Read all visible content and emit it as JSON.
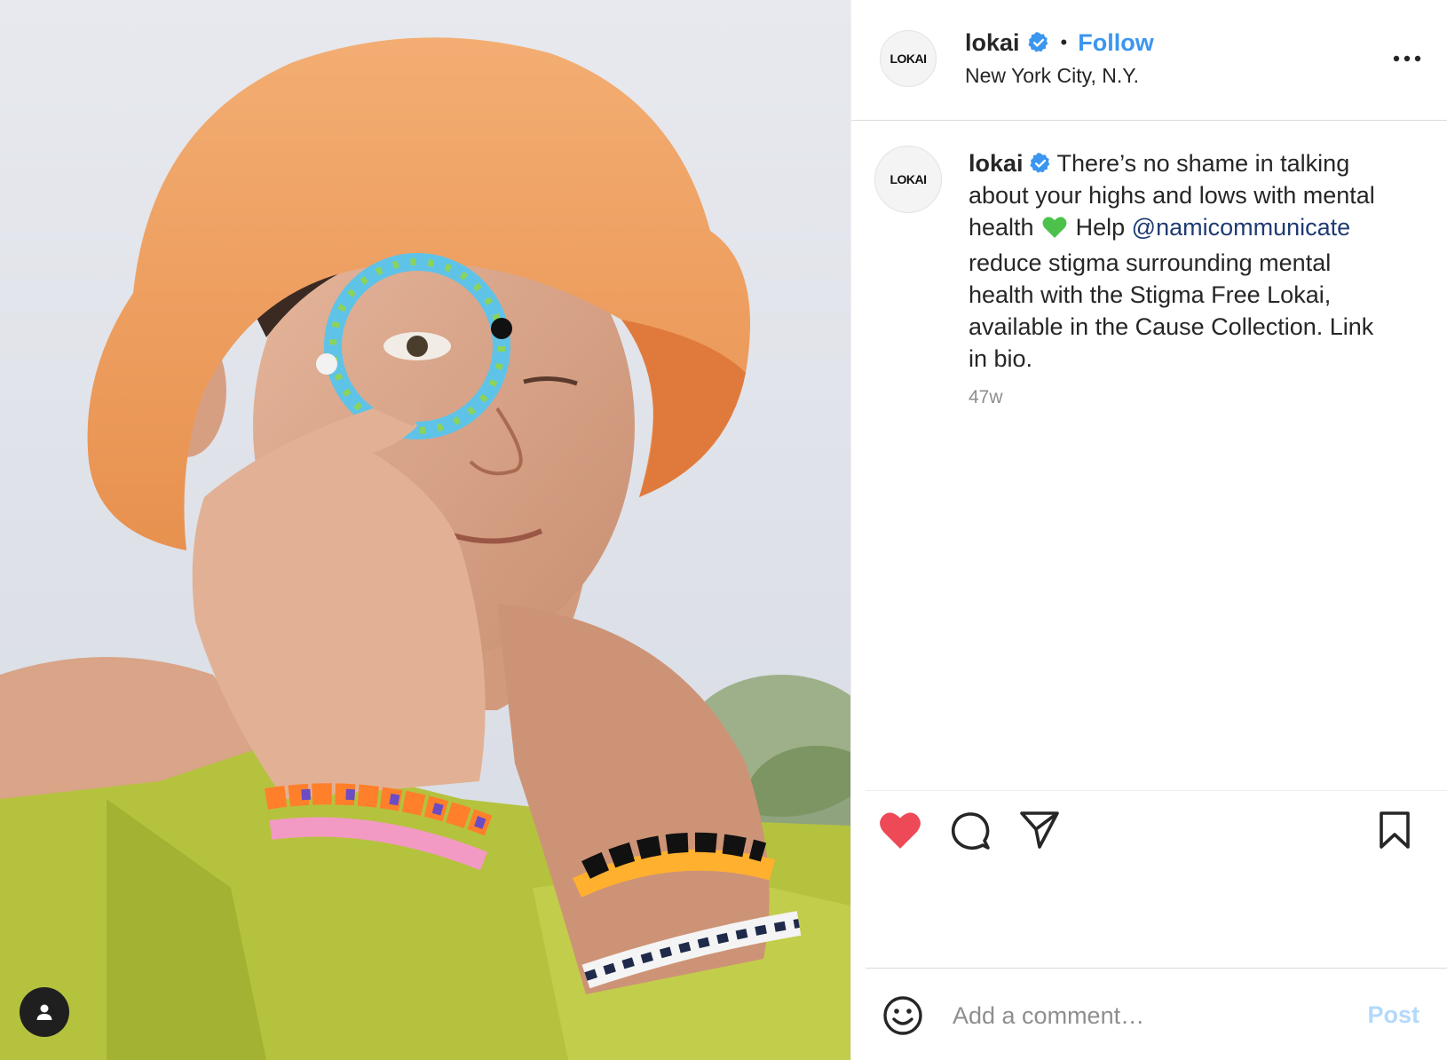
{
  "post": {
    "username": "lokai",
    "verified": true,
    "location": "New York City, N.Y.",
    "follow_label": "Follow",
    "separator": "•",
    "avatar_logo_text": "LOKAI",
    "caption_parts": {
      "text1": "There’s no shame in talking about your highs and lows with mental health",
      "text2": "Help",
      "mention": "@namicommunicate",
      "text3": "reduce stigma surrounding mental health with the Stigma Free Lokai, available in the Cause Collection. Link in bio."
    },
    "time_ago": "47w",
    "liked": true,
    "icons": {
      "like": "heart-icon",
      "comment": "comment-icon",
      "share": "share-icon",
      "save": "bookmark-icon",
      "more": "more-options-icon",
      "emoji": "emoji-icon",
      "user_tag": "user-tag-icon"
    },
    "colors": {
      "accent": "#3b96f0",
      "like": "#ed4956",
      "mention": "#1f3b73",
      "post_disabled": "#b3d9fb",
      "emoji_heart": "#4cc24c"
    }
  },
  "comment": {
    "placeholder": "Add a comment…",
    "post_label": "Post"
  }
}
